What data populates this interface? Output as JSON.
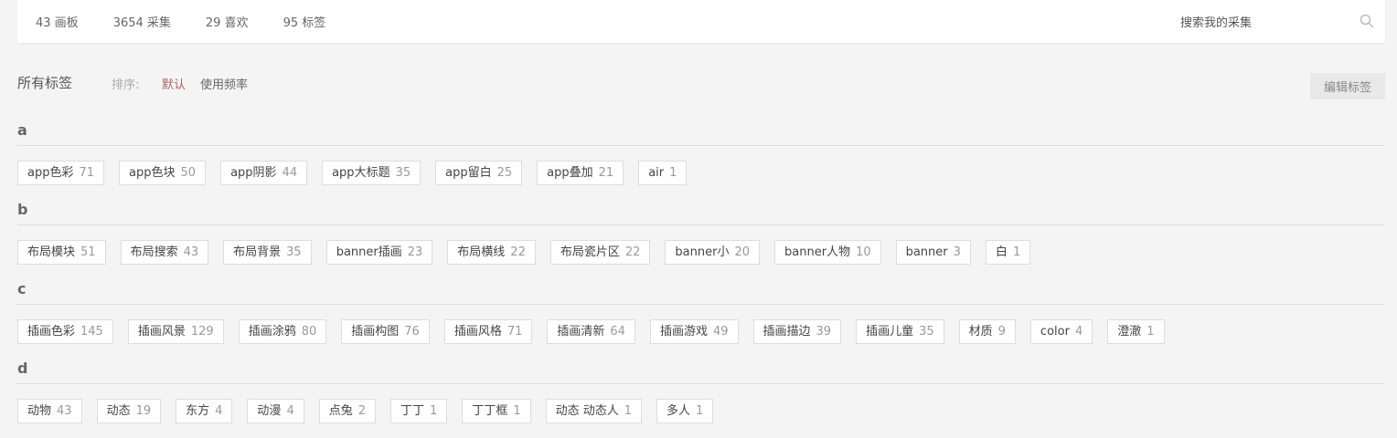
{
  "header": {
    "stats": [
      "43 画板",
      "3654 采集",
      "29 喜欢",
      "95 标签"
    ],
    "search_placeholder": "搜索我的采集"
  },
  "toolbar": {
    "title": "所有标签",
    "sort_label": "排序:",
    "sort_default": "默认",
    "sort_frequency": "使用频率",
    "edit_label": "编辑标签"
  },
  "colors": {
    "background": "#f4f4f4",
    "active_sort": "#aa6666",
    "tag_border": "#dddddd"
  },
  "groups": [
    {
      "letter": "a",
      "tags": [
        {
          "name": "app色彩",
          "count": "71"
        },
        {
          "name": "app色块",
          "count": "50"
        },
        {
          "name": "app阴影",
          "count": "44"
        },
        {
          "name": "app大标题",
          "count": "35"
        },
        {
          "name": "app留白",
          "count": "25"
        },
        {
          "name": "app叠加",
          "count": "21"
        },
        {
          "name": "air",
          "count": "1"
        }
      ]
    },
    {
      "letter": "b",
      "tags": [
        {
          "name": "布局模块",
          "count": "51"
        },
        {
          "name": "布局搜索",
          "count": "43"
        },
        {
          "name": "布局背景",
          "count": "35"
        },
        {
          "name": "banner插画",
          "count": "23"
        },
        {
          "name": "布局横线",
          "count": "22"
        },
        {
          "name": "布局瓷片区",
          "count": "22"
        },
        {
          "name": "banner小",
          "count": "20"
        },
        {
          "name": "banner人物",
          "count": "10"
        },
        {
          "name": "banner",
          "count": "3"
        },
        {
          "name": "白",
          "count": "1"
        }
      ]
    },
    {
      "letter": "c",
      "tags": [
        {
          "name": "插画色彩",
          "count": "145"
        },
        {
          "name": "插画风景",
          "count": "129"
        },
        {
          "name": "插画涂鸦",
          "count": "80"
        },
        {
          "name": "插画构图",
          "count": "76"
        },
        {
          "name": "插画风格",
          "count": "71"
        },
        {
          "name": "插画清新",
          "count": "64"
        },
        {
          "name": "插画游戏",
          "count": "49"
        },
        {
          "name": "插画描边",
          "count": "39"
        },
        {
          "name": "插画儿童",
          "count": "35"
        },
        {
          "name": "材质",
          "count": "9"
        },
        {
          "name": "color",
          "count": "4"
        },
        {
          "name": "澄澈",
          "count": "1"
        }
      ]
    },
    {
      "letter": "d",
      "tags": [
        {
          "name": "动物",
          "count": "43"
        },
        {
          "name": "动态",
          "count": "19"
        },
        {
          "name": "东方",
          "count": "4"
        },
        {
          "name": "动漫",
          "count": "4"
        },
        {
          "name": "点兔",
          "count": "2"
        },
        {
          "name": "丁丁",
          "count": "1"
        },
        {
          "name": "丁丁框",
          "count": "1"
        },
        {
          "name": "动态 动态人",
          "count": "1"
        },
        {
          "name": "多人",
          "count": "1"
        }
      ]
    }
  ]
}
